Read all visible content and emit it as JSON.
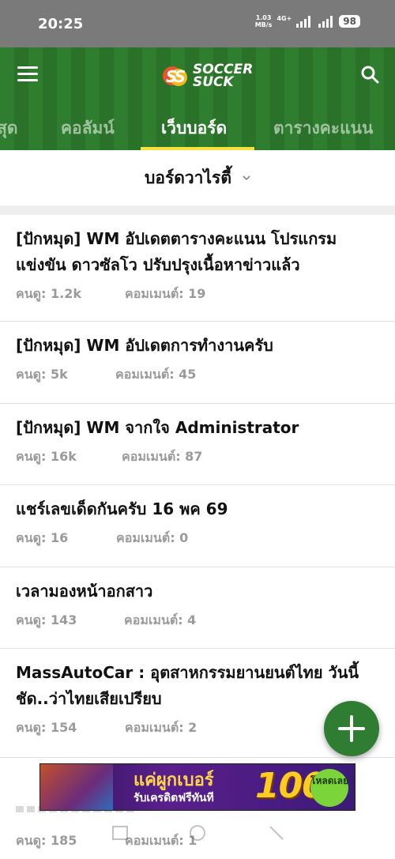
{
  "status_bar": {
    "time": "20:25",
    "net_speed_value": "1.03",
    "net_speed_unit": "MB/s",
    "network": "4G+",
    "battery": "98"
  },
  "header": {
    "logo_line1": "SOCCER",
    "logo_line2": "SUCK",
    "logo_mark": "SS",
    "menu_icon": "hamburger-menu-icon",
    "search_icon": "search-icon",
    "colors": {
      "grass": "#2f7d2f",
      "accent": "#f6e23b"
    }
  },
  "tabs": [
    {
      "label": "สุด",
      "active": false
    },
    {
      "label": "คอลัมน์",
      "active": false
    },
    {
      "label": "เว็บบอร์ด",
      "active": true
    },
    {
      "label": "ตารางคะแนน",
      "active": false
    }
  ],
  "board_selector": {
    "label": "บอร์ดวาไรตี้",
    "icon": "chevron-down-icon"
  },
  "posts": [
    {
      "title": "[ปักหมุด] WM อัปเดตตารางคะแนน โปรแกรมแข่งขัน ดาวซัลโว ปรับปรุงเนื้อหาข่าวแล้ว",
      "views": "คนดู: 1.2k",
      "comments": "คอมเมนต์: 19"
    },
    {
      "title": "[ปักหมุด] WM อัปเดตการทำงานครับ",
      "views": "คนดู: 5k",
      "comments": "คอมเมนต์: 45"
    },
    {
      "title": "[ปักหมุด] WM จากใจ Administrator",
      "views": "คนดู: 16k",
      "comments": "คอมเมนต์: 87"
    },
    {
      "title": "แชร์เลขเด็ดกันครับ 16 พค 69",
      "views": "คนดู: 16",
      "comments": "คอมเมนต์: 0"
    },
    {
      "title": "เวลามองหน้าอกสาว",
      "views": "คนดู: 143",
      "comments": "คอมเมนต์: 4"
    },
    {
      "title": "MassAutoCar : อุตสาหกรรมยานยนต์ไทย วันนี้ชัด..ว่าไทยเสียเปรียบ",
      "views": "คนดู: 154",
      "comments": "คอมเมนต์: 2"
    }
  ],
  "partial_post": {
    "views": "คนดู: 185",
    "comments": "คอมเมนต์: 1"
  },
  "fab": {
    "icon": "plus-icon",
    "color": "#2e7d32"
  },
  "ad": {
    "headline": "แค่ผูกเบอร์",
    "subline": "รับเครดิตฟรีทันที",
    "amount": "100",
    "button": "โหลดเลย"
  }
}
